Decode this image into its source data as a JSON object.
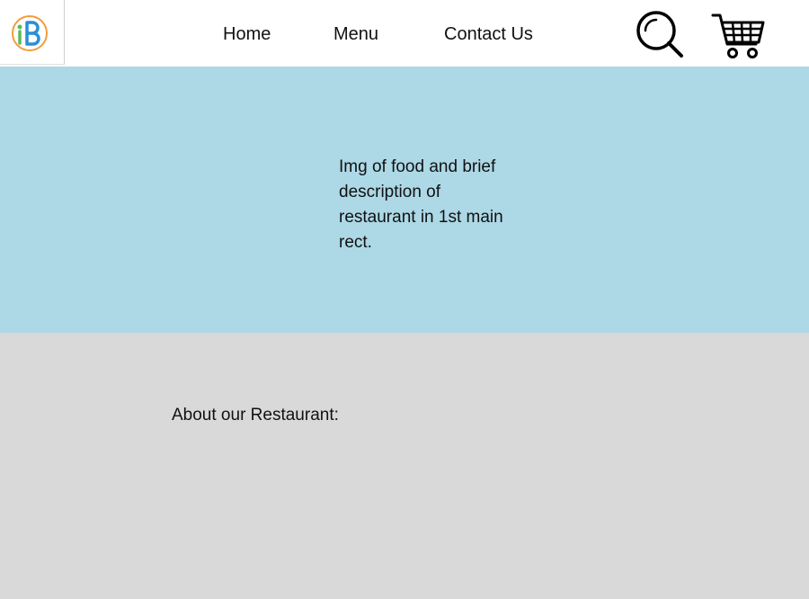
{
  "header": {
    "logo_icon": "ib-logo-icon",
    "nav": {
      "home": "Home",
      "menu": "Menu",
      "contact": "Contact Us"
    },
    "search_icon": "search-icon",
    "cart_icon": "shopping-cart-icon"
  },
  "hero": {
    "text": "Img of food and brief description of restaurant in 1st main rect.",
    "background": "#add8e6"
  },
  "about": {
    "title": "About our Restaurant:",
    "background": "#d9d9d9"
  }
}
